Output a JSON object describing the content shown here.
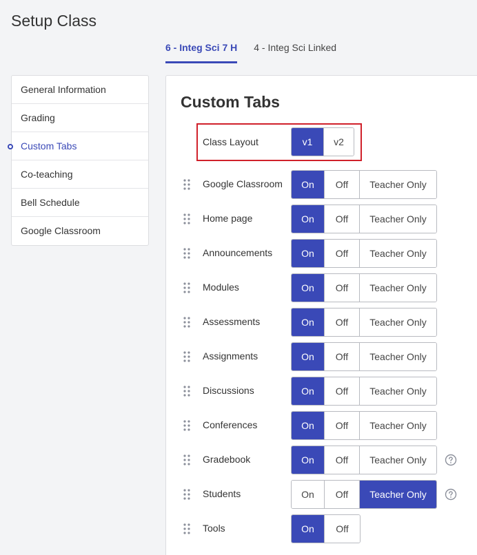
{
  "page": {
    "title": "Setup Class"
  },
  "class_tabs": [
    {
      "label": "6 - Integ Sci 7 H",
      "active": true
    },
    {
      "label": "4 - Integ Sci Linked",
      "active": false
    }
  ],
  "sidebar": {
    "items": [
      {
        "label": "General Information"
      },
      {
        "label": "Grading"
      },
      {
        "label": "Custom Tabs"
      },
      {
        "label": "Co-teaching"
      },
      {
        "label": "Bell Schedule"
      },
      {
        "label": "Google Classroom"
      }
    ],
    "active_index": 2
  },
  "main": {
    "title": "Custom Tabs",
    "class_layout": {
      "label": "Class Layout",
      "options": [
        "v1",
        "v2"
      ],
      "selected": "v1"
    },
    "option_labels": {
      "on": "On",
      "off": "Off",
      "teacher_only": "Teacher Only"
    },
    "tabs": [
      {
        "label": "Google Classroom",
        "selected": "on"
      },
      {
        "label": "Home page",
        "selected": "on"
      },
      {
        "label": "Announcements",
        "selected": "on"
      },
      {
        "label": "Modules",
        "selected": "on"
      },
      {
        "label": "Assessments",
        "selected": "on"
      },
      {
        "label": "Assignments",
        "selected": "on"
      },
      {
        "label": "Discussions",
        "selected": "on"
      },
      {
        "label": "Conferences",
        "selected": "on"
      },
      {
        "label": "Gradebook",
        "selected": "on",
        "help": true
      },
      {
        "label": "Students",
        "selected": "teacher_only",
        "help": true
      },
      {
        "label": "Tools",
        "selected": "on",
        "no_teacher_only": true
      }
    ]
  },
  "colors": {
    "accent": "#3a49b7",
    "highlight_border": "#d0202a",
    "panel_bg": "#ffffff",
    "page_bg": "#f3f4f6"
  },
  "icons": {
    "drag": "drag-handle-icon",
    "help": "help-circle-icon"
  }
}
